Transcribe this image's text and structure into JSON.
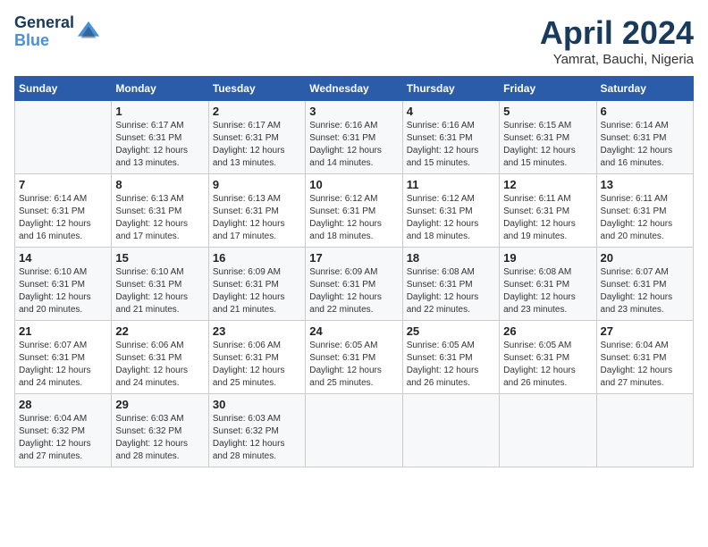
{
  "header": {
    "logo_line1": "General",
    "logo_line2": "Blue",
    "month_title": "April 2024",
    "subtitle": "Yamrat, Bauchi, Nigeria"
  },
  "weekdays": [
    "Sunday",
    "Monday",
    "Tuesday",
    "Wednesday",
    "Thursday",
    "Friday",
    "Saturday"
  ],
  "weeks": [
    [
      {
        "day": "",
        "info": ""
      },
      {
        "day": "1",
        "info": "Sunrise: 6:17 AM\nSunset: 6:31 PM\nDaylight: 12 hours\nand 13 minutes."
      },
      {
        "day": "2",
        "info": "Sunrise: 6:17 AM\nSunset: 6:31 PM\nDaylight: 12 hours\nand 13 minutes."
      },
      {
        "day": "3",
        "info": "Sunrise: 6:16 AM\nSunset: 6:31 PM\nDaylight: 12 hours\nand 14 minutes."
      },
      {
        "day": "4",
        "info": "Sunrise: 6:16 AM\nSunset: 6:31 PM\nDaylight: 12 hours\nand 15 minutes."
      },
      {
        "day": "5",
        "info": "Sunrise: 6:15 AM\nSunset: 6:31 PM\nDaylight: 12 hours\nand 15 minutes."
      },
      {
        "day": "6",
        "info": "Sunrise: 6:14 AM\nSunset: 6:31 PM\nDaylight: 12 hours\nand 16 minutes."
      }
    ],
    [
      {
        "day": "7",
        "info": "Sunrise: 6:14 AM\nSunset: 6:31 PM\nDaylight: 12 hours\nand 16 minutes."
      },
      {
        "day": "8",
        "info": "Sunrise: 6:13 AM\nSunset: 6:31 PM\nDaylight: 12 hours\nand 17 minutes."
      },
      {
        "day": "9",
        "info": "Sunrise: 6:13 AM\nSunset: 6:31 PM\nDaylight: 12 hours\nand 17 minutes."
      },
      {
        "day": "10",
        "info": "Sunrise: 6:12 AM\nSunset: 6:31 PM\nDaylight: 12 hours\nand 18 minutes."
      },
      {
        "day": "11",
        "info": "Sunrise: 6:12 AM\nSunset: 6:31 PM\nDaylight: 12 hours\nand 18 minutes."
      },
      {
        "day": "12",
        "info": "Sunrise: 6:11 AM\nSunset: 6:31 PM\nDaylight: 12 hours\nand 19 minutes."
      },
      {
        "day": "13",
        "info": "Sunrise: 6:11 AM\nSunset: 6:31 PM\nDaylight: 12 hours\nand 20 minutes."
      }
    ],
    [
      {
        "day": "14",
        "info": "Sunrise: 6:10 AM\nSunset: 6:31 PM\nDaylight: 12 hours\nand 20 minutes."
      },
      {
        "day": "15",
        "info": "Sunrise: 6:10 AM\nSunset: 6:31 PM\nDaylight: 12 hours\nand 21 minutes."
      },
      {
        "day": "16",
        "info": "Sunrise: 6:09 AM\nSunset: 6:31 PM\nDaylight: 12 hours\nand 21 minutes."
      },
      {
        "day": "17",
        "info": "Sunrise: 6:09 AM\nSunset: 6:31 PM\nDaylight: 12 hours\nand 22 minutes."
      },
      {
        "day": "18",
        "info": "Sunrise: 6:08 AM\nSunset: 6:31 PM\nDaylight: 12 hours\nand 22 minutes."
      },
      {
        "day": "19",
        "info": "Sunrise: 6:08 AM\nSunset: 6:31 PM\nDaylight: 12 hours\nand 23 minutes."
      },
      {
        "day": "20",
        "info": "Sunrise: 6:07 AM\nSunset: 6:31 PM\nDaylight: 12 hours\nand 23 minutes."
      }
    ],
    [
      {
        "day": "21",
        "info": "Sunrise: 6:07 AM\nSunset: 6:31 PM\nDaylight: 12 hours\nand 24 minutes."
      },
      {
        "day": "22",
        "info": "Sunrise: 6:06 AM\nSunset: 6:31 PM\nDaylight: 12 hours\nand 24 minutes."
      },
      {
        "day": "23",
        "info": "Sunrise: 6:06 AM\nSunset: 6:31 PM\nDaylight: 12 hours\nand 25 minutes."
      },
      {
        "day": "24",
        "info": "Sunrise: 6:05 AM\nSunset: 6:31 PM\nDaylight: 12 hours\nand 25 minutes."
      },
      {
        "day": "25",
        "info": "Sunrise: 6:05 AM\nSunset: 6:31 PM\nDaylight: 12 hours\nand 26 minutes."
      },
      {
        "day": "26",
        "info": "Sunrise: 6:05 AM\nSunset: 6:31 PM\nDaylight: 12 hours\nand 26 minutes."
      },
      {
        "day": "27",
        "info": "Sunrise: 6:04 AM\nSunset: 6:31 PM\nDaylight: 12 hours\nand 27 minutes."
      }
    ],
    [
      {
        "day": "28",
        "info": "Sunrise: 6:04 AM\nSunset: 6:32 PM\nDaylight: 12 hours\nand 27 minutes."
      },
      {
        "day": "29",
        "info": "Sunrise: 6:03 AM\nSunset: 6:32 PM\nDaylight: 12 hours\nand 28 minutes."
      },
      {
        "day": "30",
        "info": "Sunrise: 6:03 AM\nSunset: 6:32 PM\nDaylight: 12 hours\nand 28 minutes."
      },
      {
        "day": "",
        "info": ""
      },
      {
        "day": "",
        "info": ""
      },
      {
        "day": "",
        "info": ""
      },
      {
        "day": "",
        "info": ""
      }
    ]
  ]
}
